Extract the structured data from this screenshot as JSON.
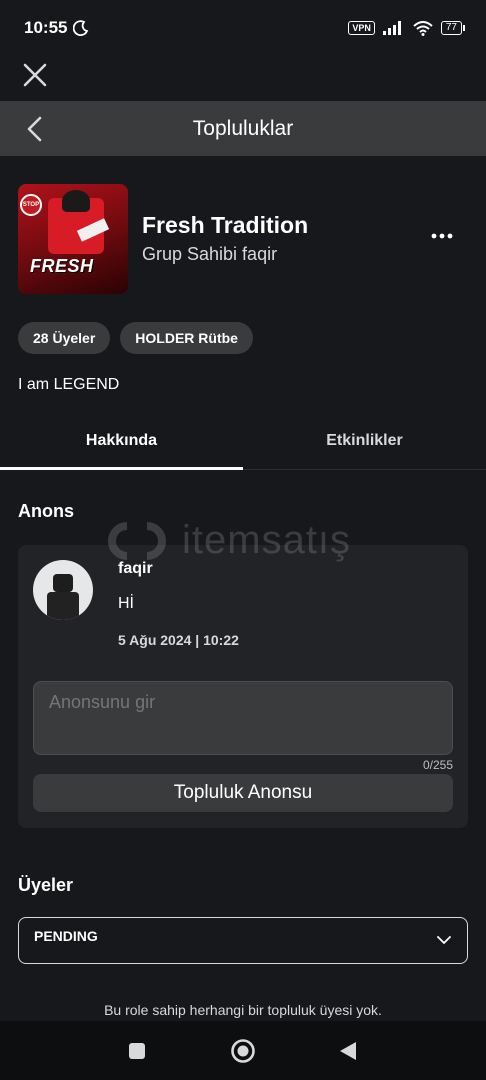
{
  "status_bar": {
    "time": "10:55",
    "vpn": "VPN",
    "battery": "77",
    "icons": [
      "moon-icon",
      "signal-icon",
      "wifi-icon",
      "battery-icon"
    ]
  },
  "nav": {
    "title": "Topluluklar"
  },
  "group": {
    "name": "Fresh Tradition",
    "owner": "Grup Sahibi faqir",
    "icon_label": "FRESH",
    "icon_stop": "STOP",
    "chips": [
      "28 Üyeler",
      "HOLDER Rütbe"
    ],
    "description": "I am LEGEND"
  },
  "tabs": [
    {
      "label": "Hakkında",
      "active": true
    },
    {
      "label": "Etkinlikler",
      "active": false
    }
  ],
  "announcement": {
    "section_title": "Anons",
    "post": {
      "user": "faqir",
      "body": "Hİ",
      "date": "5 Ağu 2024 | 10:22"
    },
    "input_placeholder": "Anonsunu gir",
    "char_count": "0/255",
    "button_label": "Topluluk Anonsu"
  },
  "watermark": "itemsatış",
  "members": {
    "section_title": "Üyeler",
    "role_selected": "PENDING",
    "empty_message": "Bu role sahip herhangi bir topluluk üyesi yok."
  },
  "colors": {
    "background": "#17181b",
    "nav_bar": "#393b3d",
    "card": "#212326",
    "chip": "#393b3d",
    "text_primary": "#ffffff",
    "text_secondary": "#d8d9da"
  }
}
